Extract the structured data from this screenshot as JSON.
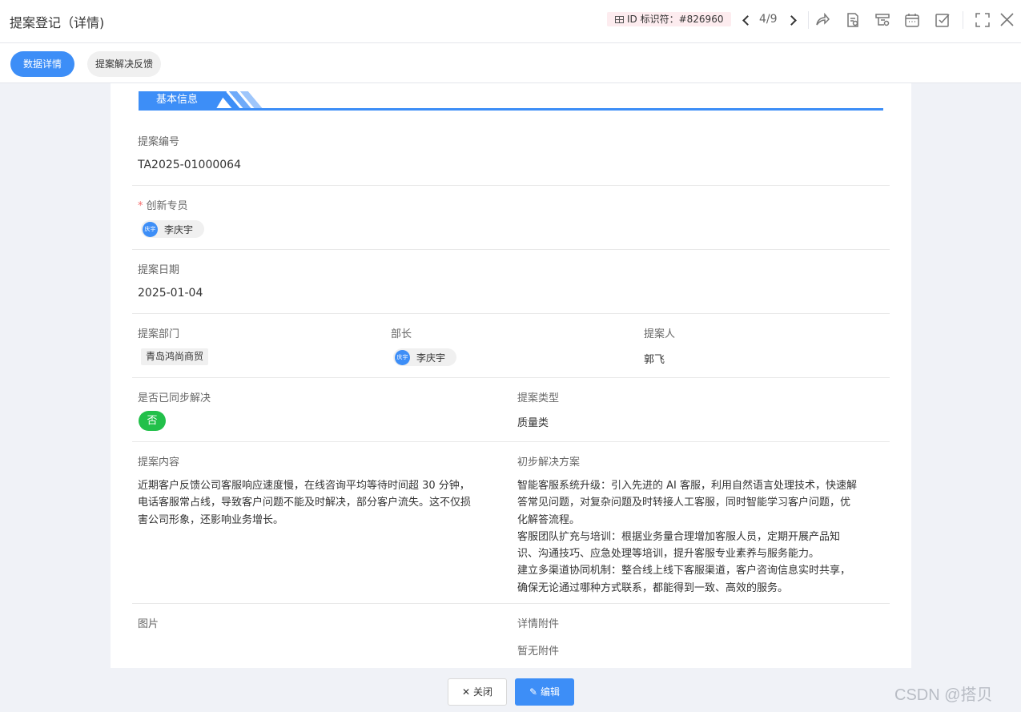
{
  "header": {
    "title": "提案登记（详情)",
    "id_badge": "ID  标识符：#826960",
    "page_counter": "4/9"
  },
  "toolbar_icons": [
    "share-icon",
    "doc-icon",
    "print-icon",
    "calendar-icon",
    "checkbox-icon",
    "fullscreen-icon",
    "close-icon"
  ],
  "tabs": [
    {
      "label": "数据详情",
      "active": true
    },
    {
      "label": "提案解决反馈",
      "active": false
    }
  ],
  "section": {
    "title": "基本信息"
  },
  "fields": {
    "proposal_no": {
      "label": "提案编号",
      "value": "TA2025-01000064"
    },
    "specialist": {
      "label": "创新专员",
      "required": "*",
      "avatar": "庆宇",
      "name": "李庆宇"
    },
    "date": {
      "label": "提案日期",
      "value": "2025-01-04"
    },
    "department": {
      "label": "提案部门",
      "value": "青岛鸿尚商贸"
    },
    "minister": {
      "label": "部长",
      "avatar": "庆宇",
      "name": "李庆宇"
    },
    "proposer": {
      "label": "提案人",
      "value": "郭飞"
    },
    "synced": {
      "label": "是否已同步解决",
      "value": "否"
    },
    "type": {
      "label": "提案类型",
      "value": "质量类"
    },
    "content": {
      "label": "提案内容",
      "lines": [
        "近期客户反馈公司客服响应速度慢，在线咨询平均等待时间超 30 分钟，",
        "电话客服常占线，导致客户问题不能及时解决，部分客户流失。这不仅损",
        "害公司形象，还影响业务增长。"
      ]
    },
    "solution": {
      "label": "初步解决方案",
      "lines": [
        "智能客服系统升级：引入先进的 AI 客服，利用自然语言处理技术，快速解",
        "答常见问题，对复杂问题及时转接人工客服，同时智能学习客户问题，优",
        "化解答流程。",
        "客服团队扩充与培训：根据业务量合理增加客服人员，定期开展产品知",
        "识、沟通技巧、应急处理等培训，提升客服专业素养与服务能力。",
        "建立多渠道协同机制：整合线上线下客服渠道，客户咨询信息实时共享，",
        "确保无论通过哪种方式联系，都能得到一致、高效的服务。"
      ]
    },
    "image": {
      "label": "图片"
    },
    "attachments": {
      "label": "详情附件",
      "value": "暂无附件"
    }
  },
  "footer": {
    "close_icon": "✕",
    "close_label": "关闭",
    "edit_icon": "✎",
    "edit_label": "编辑"
  },
  "watermark": "CSDN @搭贝"
}
